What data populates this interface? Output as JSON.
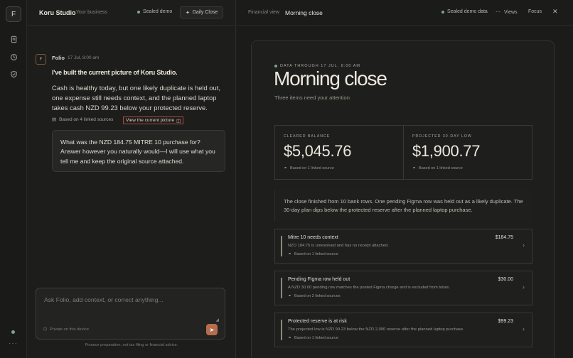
{
  "rail": {
    "logo": "F",
    "more": "···"
  },
  "left": {
    "brand": "Koru Studio",
    "business": "Your business",
    "sealed": "Sealed demo",
    "daily": "Daily Close",
    "message": {
      "avatar": "F",
      "author": "Folio",
      "time": "17 Jul, 8:00 am",
      "headline": "I've built the current picture of Koru Studio.",
      "body": "Cash is healthy today, but one likely duplicate is held out, one expense still needs context, and the planned laptop takes cash NZD 99.23 below your protected reserve.",
      "sources": "Based on 4 linked sources",
      "view_link": "View the current picture"
    },
    "user_bubble": "What was the NZD 184.75 MITRE 10 purchase for? Answer however you naturally would—I will use what you tell me and keep the original source attached.",
    "composer": {
      "placeholder": "Ask Folio, add context, or correct anything...",
      "private": "Private on this device",
      "send": "➤"
    },
    "disclaimer": "Finance preparation, not tax filing or financial advice."
  },
  "right": {
    "crumb": "Financial view",
    "title": "Morning close",
    "sealed": "Sealed demo data",
    "views": "Views",
    "focus": "Focus",
    "close": "✕",
    "doc": {
      "data_through": "DATA THROUGH 17 JUL, 8:00 AM",
      "title": "Morning close",
      "subtitle": "Three items need your attention",
      "metrics": [
        {
          "label": "CLEARED BALANCE",
          "value": "$5,045.76",
          "source": "Based on 1 linked source"
        },
        {
          "label": "PROJECTED 30-DAY LOW",
          "value": "$1,900.77",
          "source": "Based on 1 linked source"
        }
      ],
      "summary": "The close finished from 10 bank rows. One pending Figma row was held out as a likely duplicate. The 30-day plan dips below the protected reserve after the planned laptop purchase.",
      "cards": [
        {
          "title": "Mitre 10 needs context",
          "amount": "$184.75",
          "desc": "NZD 184.75 is unresolved and has no receipt attached.",
          "source": "Based on 1 linked source"
        },
        {
          "title": "Pending Figma row held out",
          "amount": "$30.00",
          "desc": "A NZD 30.00 pending row matches the posted Figma charge and is excluded from totals.",
          "source": "Based on 2 linked sources"
        },
        {
          "title": "Protected reserve is at risk",
          "amount": "$99.23",
          "desc": "The projected low is NZD 99.23 below the NZD 2,000 reserve after the planned laptop purchase.",
          "source": "Based on 1 linked source"
        }
      ]
    }
  }
}
